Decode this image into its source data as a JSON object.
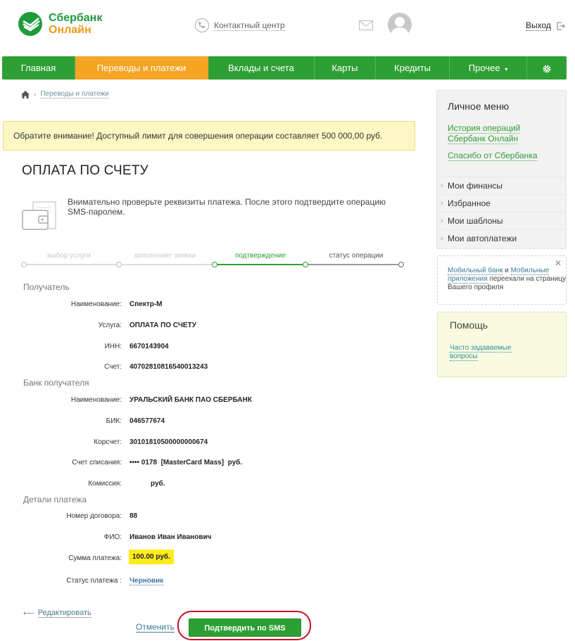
{
  "header": {
    "logo_line1": "Сбербанк",
    "logo_line2": "Онлайн",
    "contact_center": "Контактный центр",
    "exit": "Выход"
  },
  "nav": {
    "items": [
      {
        "label": "Главная",
        "active": false
      },
      {
        "label": "Переводы и платежи",
        "active": true
      },
      {
        "label": "Вклады и счета",
        "active": false
      },
      {
        "label": "Карты",
        "active": false
      },
      {
        "label": "Кредиты",
        "active": false
      },
      {
        "label": "Прочее",
        "active": false
      }
    ]
  },
  "breadcrumb": {
    "current": "Переводы и платежи"
  },
  "notice": "Обратите внимание! Доступный лимит для совершения операции составляет 500 000,00 руб.",
  "page_title": "ОПЛАТА ПО СЧЕТУ",
  "intro": "Внимательно проверьте реквизиты платежа. После этого подтвердите операцию SMS-паролем.",
  "steps": [
    {
      "label": "выбор услуги",
      "state": "past"
    },
    {
      "label": "заполнение заявки",
      "state": "past"
    },
    {
      "label": "подтверждение",
      "state": "current"
    },
    {
      "label": "статус операции",
      "state": "next"
    }
  ],
  "recipient": {
    "section": "Получатель",
    "name_label": "Наименование:",
    "name_value": "Спектр-М",
    "service_label": "Услуга:",
    "service_value": "ОПЛАТА ПО СЧЕТУ",
    "inn_label": "ИНН:",
    "inn_value": "6670143904",
    "account_label": "Счет:",
    "account_value": "40702810816540013243"
  },
  "bank": {
    "section": "Банк получателя",
    "name_label": "Наименование:",
    "name_value": "УРАЛЬСКИЙ БАНК ПАО СБЕРБАНК",
    "bik_label": "БИК:",
    "bik_value": "046577674",
    "corr_label": "Корсчет:",
    "corr_value": "30101810500000000674",
    "debit_label": "Счет списания:",
    "debit_value": "•••• 0178  [MasterCard Mass]  руб.",
    "fee_label": "Комиссия:",
    "fee_value": "руб."
  },
  "details": {
    "section": "Детали платежа",
    "contract_label": "Номер договора:",
    "contract_value": "88",
    "fio_label": "ФИО:",
    "fio_value": "Иванов Иван Иванович",
    "amount_label": "Сумма платежа:",
    "amount_value": "100.00 руб.",
    "status_label": "Статус платежа :",
    "status_value": "Черновик"
  },
  "actions": {
    "edit": "Редактировать",
    "cancel": "Отменить",
    "confirm": "Подтвердить по SMS"
  },
  "sidebar": {
    "menu_title": "Личное меню",
    "history_link": "История операций Сбербанк Онлайн",
    "thanks_link": "Спасибо от Сбербанка",
    "items": [
      "Мои финансы",
      "Избранное",
      "Мои шаблоны",
      "Мои автоплатежи"
    ],
    "mobile_link1": "Мобильный банк",
    "mobile_and": " и ",
    "mobile_link2": "Мобильные приложения",
    "mobile_text": " переехали на страницу Вашего профиля",
    "help_title": "Помощь",
    "help_link": "Часто задаваемые вопросы"
  },
  "colors": {
    "brand_green": "#2e9f34",
    "active_orange": "#f6a423",
    "notice_bg": "#fdf7c3",
    "highlight_yellow": "#fdeb1b",
    "confirm_outline": "#c8102e"
  }
}
